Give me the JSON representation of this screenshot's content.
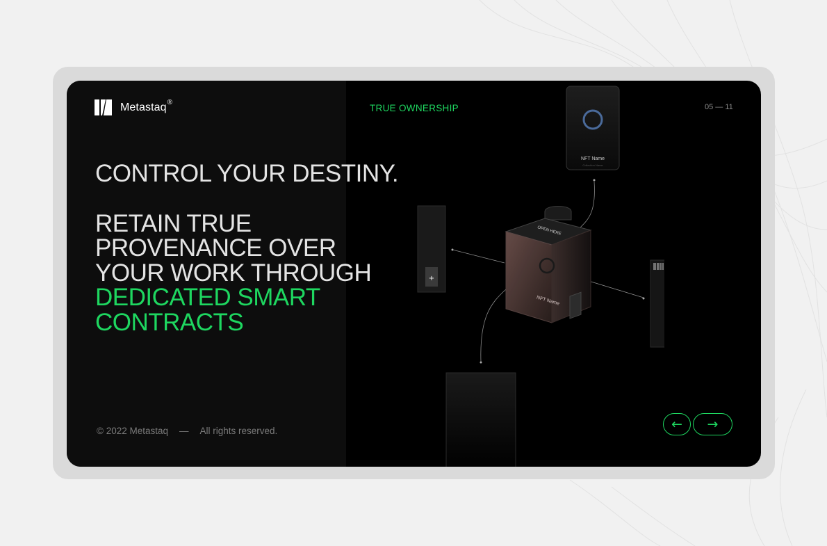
{
  "brand": {
    "name": "Metastaq",
    "registered": "®"
  },
  "headline": {
    "part1": "CONTROL YOUR DESTINY.",
    "part2": "RETAIN TRUE PROVENANCE OVER YOUR WORK THROUGH",
    "highlight": "DEDICATED SMART CONTRACTS"
  },
  "section_label": "TRUE OWNERSHIP",
  "page_counter": "05 — 11",
  "footer": {
    "copyright": "© 2022 Metastaq",
    "separator": "—",
    "rights": "All rights reserved."
  },
  "illustration": {
    "box_top_text": "OPEN HERE",
    "box_card_text": "NFT Name",
    "top_card_title": "NFT Name",
    "top_card_subtitle": "Collection Name"
  },
  "navigation": {
    "prev_icon": "←",
    "next_icon": "→"
  },
  "colors": {
    "accent": "#1ed760",
    "panel": "#0d0d0d",
    "background": "#000000",
    "page": "#f1f1f1"
  },
  "icons": [
    "logo-mark-icon",
    "arrow-left-icon",
    "arrow-right-icon"
  ]
}
